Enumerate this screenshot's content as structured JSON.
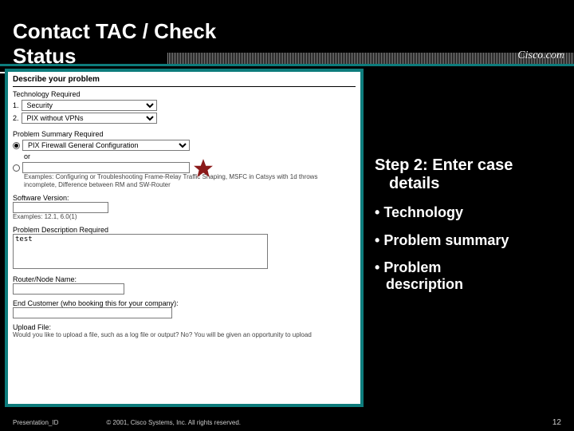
{
  "title": "Contact TAC / Check Status",
  "brand": "Cisco.com",
  "form": {
    "describe_header": "Describe your problem",
    "tech_label": "Technology Required",
    "tech_sel1_num": "1.",
    "tech_sel1_val": "Security",
    "tech_sel2_num": "2.",
    "tech_sel2_val": "PIX without VPNs",
    "summary_label": "Problem Summary Required",
    "summary_val": "PIX Firewall General Configuration",
    "or": "or",
    "summary_hint": "Examples: Configuring or Troubleshooting Frame-Relay Traffic Shaping, MSFC in Catsys with 1d throws incomplete, Difference between RM and SW-Router",
    "sw_label": "Software Version:",
    "sw_hint": "Examples: 12.1, 6.0(1)",
    "desc_label": "Problem Description Required",
    "desc_val": "test",
    "node_label": "Router/Node Name:",
    "endcust_label": "End Customer (who booking this for your company):",
    "upload_label": "Upload File:",
    "upload_hint": "Would you like to upload a file, such as a log file or output? No? You will be given an opportunity to upload"
  },
  "right": {
    "step_line1": "Step 2:  Enter case",
    "step_line2": "details",
    "b1": "Technology",
    "b2": "Problem summary",
    "b3_line1": "Problem",
    "b3_line2": "description"
  },
  "footer": {
    "pid": "Presentation_ID",
    "copy": "© 2001, Cisco Systems, Inc. All rights reserved.",
    "page": "12"
  }
}
